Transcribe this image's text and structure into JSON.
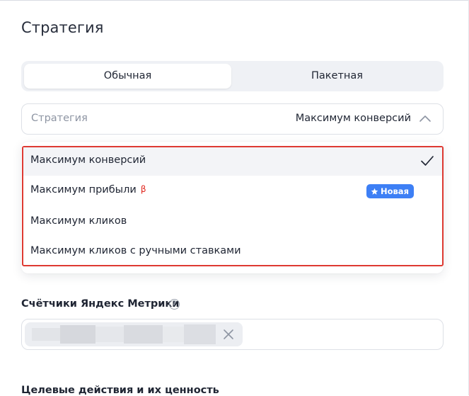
{
  "page": {
    "title": "Стратегия"
  },
  "segmented": {
    "options": [
      "Обычная",
      "Пакетная"
    ],
    "active": "Обычная"
  },
  "strategy_select": {
    "label": "Стратегия",
    "value": "Максимум конверсий",
    "chevron_icon": "chevron-up-icon"
  },
  "dropdown": {
    "border_color": "#de3a32",
    "options": [
      {
        "label": "Максимум конверсий",
        "selected": true,
        "icon": "check-icon"
      },
      {
        "label": "Максимум прибыли",
        "beta": "β",
        "badge": "Новая",
        "badge_icon": "star-icon",
        "badge_color": "#3d7ff5"
      },
      {
        "label": "Максимум кликов"
      },
      {
        "label": "Максимум кликов с ручными ставками"
      }
    ]
  },
  "metrika": {
    "label": "Счётчики Яндекс Метрики",
    "help_icon": "question-circle-icon",
    "chip_icon": "close-icon"
  },
  "goals": {
    "label": "Целевые действия и их ценность"
  }
}
